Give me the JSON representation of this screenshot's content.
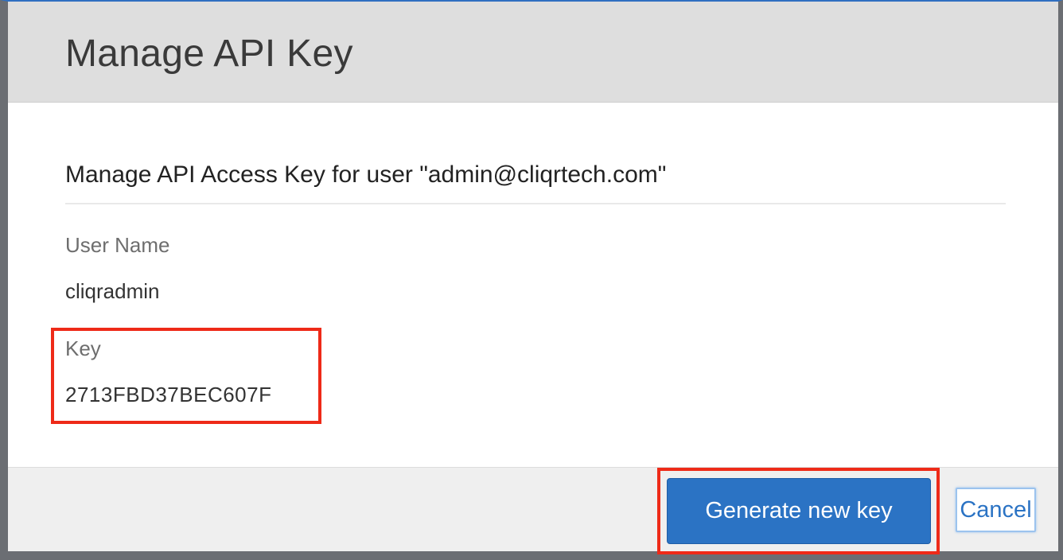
{
  "dialog": {
    "title": "Manage API Key"
  },
  "body": {
    "heading": "Manage API Access Key for user \"admin@cliqrtech.com\"",
    "user_name_label": "User Name",
    "user_name_value": "cliqradmin",
    "key_label": "Key",
    "key_value": "2713FBD37BEC607F"
  },
  "footer": {
    "generate_label": "Generate new key",
    "cancel_label": "Cancel"
  },
  "colors": {
    "primary_button": "#2b73c4",
    "highlight_box": "#ee2a18",
    "header_bg": "#dedede"
  }
}
